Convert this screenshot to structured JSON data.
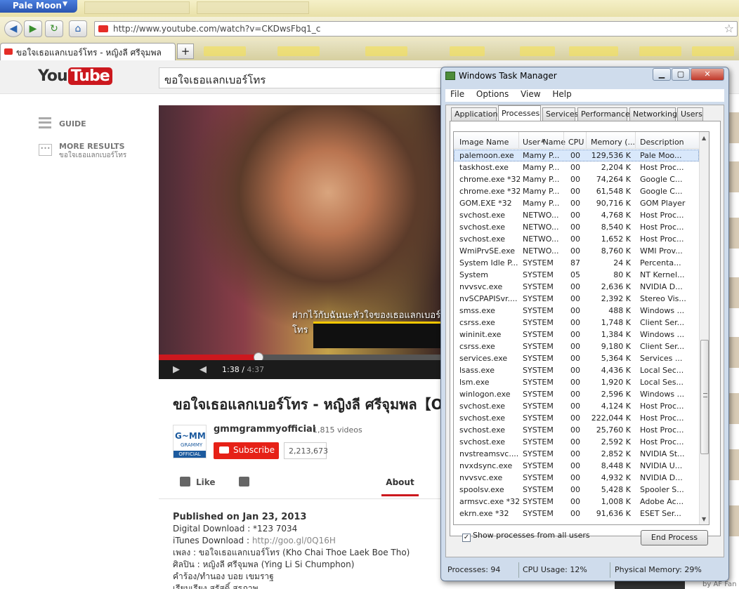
{
  "browser": {
    "menu_label": "Pale Moon",
    "url": "http://www.youtube.com/watch?v=CKDwsFbq1_c",
    "active_tab_title": "ขอใจเธอแลกเบอร์โทร - หญิงลี ศรีจุมพล",
    "new_tab_label": "+"
  },
  "youtube": {
    "logo_you": "You",
    "logo_tube": "Tube",
    "search_value": "ขอใจเธอแลกเบอร์โทร",
    "guide_label": "GUIDE",
    "more_results_label": "MORE RESULTS",
    "more_results_query": "ขอใจเธอแลกเบอร์โทร",
    "video": {
      "subtitle": "ฝากไว้กับฉันนะหัวใจของเธอแลกเบอร์โทร",
      "current_time": "1:38",
      "duration": "4:37",
      "progress": 0.354
    },
    "title": "ขอใจเธอแลกเบอร์โทร - หญิงลี ศรีจุมพล【OFFICIAL】",
    "channel": {
      "logo_text": "G~MM",
      "logo_sub": "GRAMMY",
      "logo_badge": "OFFICIAL",
      "name": "gmmgrammyofficial",
      "video_count": "1,815 videos",
      "subscribe_label": "Subscribe",
      "subscriber_count": "2,213,673"
    },
    "like_label": "Like",
    "about_tab": "About",
    "description": {
      "published": "Published on Jan 23, 2013",
      "digital_download": "Digital Download : *123 7034",
      "itunes_prefix": "iTunes Download : ",
      "itunes_link": "http://goo.gl/0Q16H",
      "song": "เพลง : ขอใจเธอแลกเบอร์โทร (Kho Chai Thoe Laek Boe Tho)",
      "artist": "ศิลปิน : หญิงลี ศรีจุมพล (Ying Li Si Chumphon)",
      "lyrics": "คำร้อง/ทำนอง บอย เขมราฐ",
      "arrange": "เรียบเรียง สุรัสดิ์ สุรภาพ"
    },
    "bottom_credit": "by AF Fan"
  },
  "task_manager": {
    "title": "Windows Task Manager",
    "menu": [
      "File",
      "Options",
      "View",
      "Help"
    ],
    "tabs": [
      "Applications",
      "Processes",
      "Services",
      "Performance",
      "Networking",
      "Users"
    ],
    "active_tab": "Processes",
    "columns": [
      "Image Name",
      "User Name",
      "CPU",
      "Memory (...",
      "Description"
    ],
    "rows": [
      [
        "palemoon.exe",
        "Mamy P...",
        "00",
        "129,536 K",
        "Pale Moo..."
      ],
      [
        "taskhost.exe",
        "Mamy P...",
        "00",
        "2,204 K",
        "Host Proc..."
      ],
      [
        "chrome.exe *32",
        "Mamy P...",
        "00",
        "74,264 K",
        "Google C..."
      ],
      [
        "chrome.exe *32",
        "Mamy P...",
        "00",
        "61,548 K",
        "Google C..."
      ],
      [
        "GOM.EXE *32",
        "Mamy P...",
        "00",
        "90,716 K",
        "GOM Player"
      ],
      [
        "svchost.exe",
        "NETWO...",
        "00",
        "4,768 K",
        "Host Proc..."
      ],
      [
        "svchost.exe",
        "NETWO...",
        "00",
        "8,540 K",
        "Host Proc..."
      ],
      [
        "svchost.exe",
        "NETWO...",
        "00",
        "1,652 K",
        "Host Proc..."
      ],
      [
        "WmiPrvSE.exe",
        "NETWO...",
        "00",
        "8,760 K",
        "WMI Prov..."
      ],
      [
        "System Idle P...",
        "SYSTEM",
        "87",
        "24 K",
        "Percenta..."
      ],
      [
        "System",
        "SYSTEM",
        "05",
        "80 K",
        "NT Kernel..."
      ],
      [
        "nvvsvc.exe",
        "SYSTEM",
        "00",
        "2,636 K",
        "NVIDIA D..."
      ],
      [
        "nvSCPAPISvr....",
        "SYSTEM",
        "00",
        "2,392 K",
        "Stereo Vis..."
      ],
      [
        "smss.exe",
        "SYSTEM",
        "00",
        "488 K",
        "Windows ..."
      ],
      [
        "csrss.exe",
        "SYSTEM",
        "00",
        "1,748 K",
        "Client Ser..."
      ],
      [
        "wininit.exe",
        "SYSTEM",
        "00",
        "1,384 K",
        "Windows ..."
      ],
      [
        "csrss.exe",
        "SYSTEM",
        "00",
        "9,180 K",
        "Client Ser..."
      ],
      [
        "services.exe",
        "SYSTEM",
        "00",
        "5,364 K",
        "Services ..."
      ],
      [
        "lsass.exe",
        "SYSTEM",
        "00",
        "4,436 K",
        "Local Sec..."
      ],
      [
        "lsm.exe",
        "SYSTEM",
        "00",
        "1,920 K",
        "Local Ses..."
      ],
      [
        "winlogon.exe",
        "SYSTEM",
        "00",
        "2,596 K",
        "Windows ..."
      ],
      [
        "svchost.exe",
        "SYSTEM",
        "00",
        "4,124 K",
        "Host Proc..."
      ],
      [
        "svchost.exe",
        "SYSTEM",
        "00",
        "222,044 K",
        "Host Proc..."
      ],
      [
        "svchost.exe",
        "SYSTEM",
        "00",
        "25,760 K",
        "Host Proc..."
      ],
      [
        "svchost.exe",
        "SYSTEM",
        "00",
        "2,592 K",
        "Host Proc..."
      ],
      [
        "nvstreamsvc....",
        "SYSTEM",
        "00",
        "2,852 K",
        "NVIDIA St..."
      ],
      [
        "nvxdsync.exe",
        "SYSTEM",
        "00",
        "8,448 K",
        "NVIDIA U..."
      ],
      [
        "nvvsvc.exe",
        "SYSTEM",
        "00",
        "4,932 K",
        "NVIDIA D..."
      ],
      [
        "spoolsv.exe",
        "SYSTEM",
        "00",
        "5,428 K",
        "Spooler S..."
      ],
      [
        "armsvc.exe *32",
        "SYSTEM",
        "00",
        "1,008 K",
        "Adobe Ac..."
      ],
      [
        "ekrn.exe *32",
        "SYSTEM",
        "00",
        "91,636 K",
        "ESET Ser..."
      ]
    ],
    "show_all_label": "Show processes from all users",
    "end_process_label": "End Process",
    "status": {
      "processes": "Processes: 94",
      "cpu": "CPU Usage: 12%",
      "memory": "Physical Memory: 29%"
    }
  }
}
